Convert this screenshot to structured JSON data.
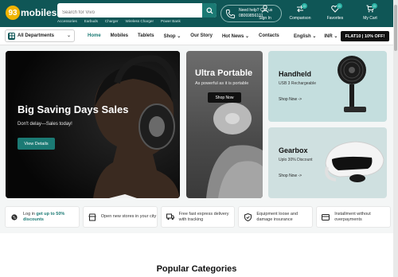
{
  "header": {
    "logo_number": "93",
    "logo_text": "mobiles",
    "search_placeholder": "Search for Vivo",
    "suggestions": [
      "Accessories",
      "Earbuds",
      "Charger",
      "Wireless Charger",
      "Power Bank"
    ],
    "help_title": "Need help? Call us",
    "help_phone": "08069856101",
    "icons": [
      {
        "label": "Sign In",
        "icon": "user-icon"
      },
      {
        "label": "Comparison",
        "icon": "compare-icon",
        "count": "0"
      },
      {
        "label": "Favorites",
        "icon": "heart-icon",
        "count": "0"
      },
      {
        "label": "My Cart",
        "icon": "cart-icon",
        "count": "0"
      }
    ]
  },
  "nav": {
    "departments": "All Departments",
    "links": [
      "Home",
      "Mobiles",
      "Tablets",
      "Shop",
      "Our Story",
      "Hot News",
      "Contacts"
    ],
    "language": "English",
    "currency": "INR",
    "promo": "FLAT10 | 10% OFF!"
  },
  "hero": {
    "title": "Big Saving Days Sales",
    "subtitle": "Don't delay—Sales today!",
    "button": "View Details"
  },
  "ultra": {
    "title": "Ultra Portable",
    "subtitle": "As powerful as it is portable",
    "button": "Shop Now"
  },
  "handheld": {
    "title": "Handheld",
    "subtitle": "USB 3 Rechargeable",
    "link": "Shop Now ->"
  },
  "gearbox": {
    "title": "Gearbox",
    "subtitle": "Uplo 30% Discount",
    "link": "Shop Now ->"
  },
  "features": [
    {
      "pre": "Log in ",
      "highlight": "get up to 50% discounts",
      "post": "",
      "icon": "discount-icon"
    },
    {
      "pre": "Open new stores in your city",
      "highlight": "",
      "post": "",
      "icon": "store-icon"
    },
    {
      "pre": "Free fast express delivery with tracking",
      "highlight": "",
      "post": "",
      "icon": "truck-icon"
    },
    {
      "pre": "Equipment loose and damage insurance",
      "highlight": "",
      "post": "",
      "icon": "shield-icon"
    },
    {
      "pre": "Installment without overpayments",
      "highlight": "",
      "post": "",
      "icon": "card-icon"
    }
  ],
  "section_title": "Popular Categories",
  "colors": {
    "primary": "#0f5656",
    "accent": "#1b7a74",
    "badge": "#f0b400"
  }
}
